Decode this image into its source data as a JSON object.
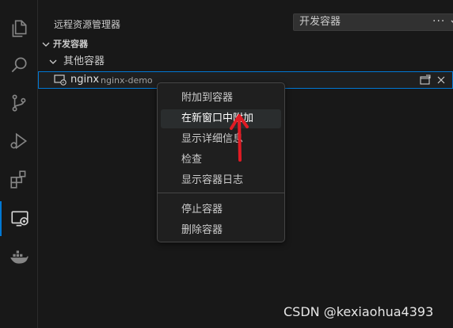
{
  "activity_bar": {
    "items": [
      {
        "icon": "files-icon"
      },
      {
        "icon": "search-icon"
      },
      {
        "icon": "source-control-icon"
      },
      {
        "icon": "run-debug-icon"
      },
      {
        "icon": "extensions-icon"
      },
      {
        "icon": "remote-explorer-icon",
        "active": true
      },
      {
        "icon": "docker-icon"
      }
    ]
  },
  "sidebar": {
    "title": "远程资源管理器",
    "remote_select": {
      "value": "开发容器"
    },
    "more_actions": "···"
  },
  "tree": {
    "section": "开发容器",
    "group": "其他容器",
    "selected_item": {
      "name": "nginx",
      "description": "nginx-demo",
      "icon": "container-icon"
    }
  },
  "context_menu": {
    "group1": [
      "附加到容器",
      "在新窗口中附加",
      "显示详细信息",
      "检查",
      "显示容器日志"
    ],
    "group2": [
      "停止容器",
      "删除容器"
    ],
    "hovered": "在新窗口中附加"
  },
  "watermark": "CSDN @kexiaohua4393",
  "colors": {
    "accent": "#0078d4",
    "background": "#181818",
    "annotation_arrow": "#e01b24"
  }
}
